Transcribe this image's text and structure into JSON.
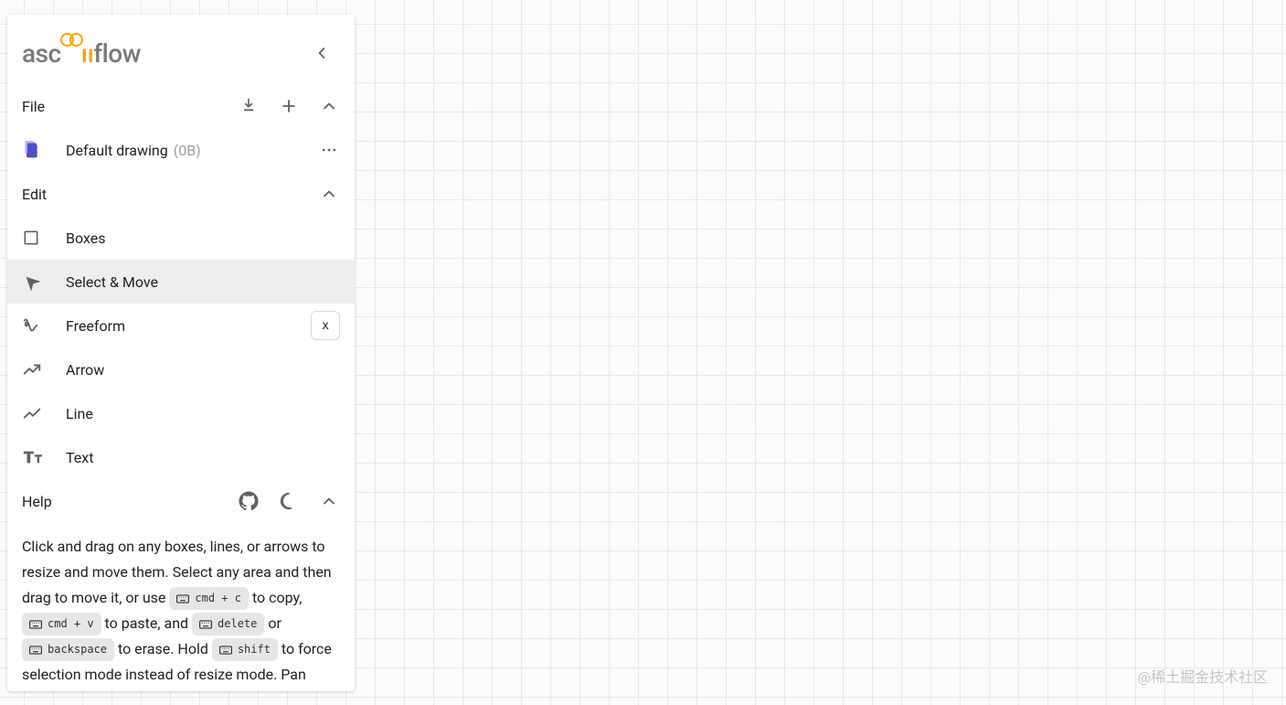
{
  "logo": {
    "pre": "asc",
    "post": "flow"
  },
  "file": {
    "section_label": "File",
    "drawing_name": "Default drawing",
    "drawing_size": "(0B)"
  },
  "edit": {
    "section_label": "Edit",
    "tools": [
      {
        "label": "Boxes"
      },
      {
        "label": "Select & Move"
      },
      {
        "label": "Freeform",
        "key": "x"
      },
      {
        "label": "Arrow"
      },
      {
        "label": "Line"
      },
      {
        "label": "Text"
      }
    ]
  },
  "help": {
    "section_label": "Help",
    "p1": "Click and drag on any boxes, lines, or arrows to resize and move them. Select any area and then drag to move it, or use ",
    "k1": "cmd + c",
    "p2": " to copy, ",
    "k2": "cmd + v",
    "p3": " to paste, and ",
    "k3": "delete",
    "p4": " or ",
    "k4": "backspace",
    "p5": " to erase. Hold ",
    "k5": "shift",
    "p6": " to force selection mode instead of resize mode. Pan"
  },
  "watermark": "@稀土掘金技术社区"
}
